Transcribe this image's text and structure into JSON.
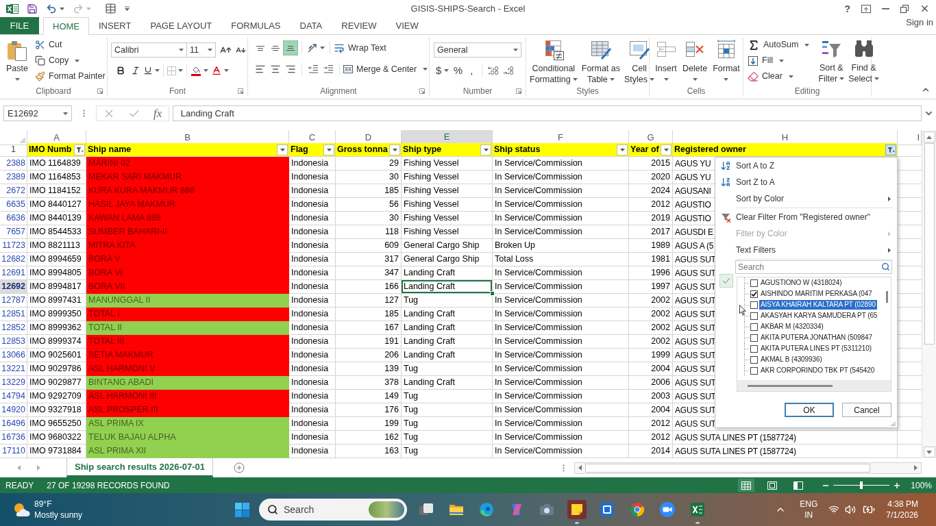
{
  "window": {
    "title": "GISIS-SHIPS-Search - Excel",
    "help": "?",
    "sign_in": "Sign in"
  },
  "ribbon_tabs": [
    {
      "label": "FILE",
      "kind": "file",
      "selected": false
    },
    {
      "label": "HOME",
      "kind": "tab",
      "selected": true
    },
    {
      "label": "INSERT",
      "kind": "tab",
      "selected": false
    },
    {
      "label": "PAGE LAYOUT",
      "kind": "tab",
      "selected": false
    },
    {
      "label": "FORMULAS",
      "kind": "tab",
      "selected": false
    },
    {
      "label": "DATA",
      "kind": "tab",
      "selected": false
    },
    {
      "label": "REVIEW",
      "kind": "tab",
      "selected": false
    },
    {
      "label": "VIEW",
      "kind": "tab",
      "selected": false
    }
  ],
  "ribbon": {
    "clipboard": {
      "label": "Clipboard",
      "paste": "Paste",
      "cut": "Cut",
      "copy": "Copy",
      "format_painter": "Format Painter"
    },
    "font": {
      "label": "Font",
      "font_name": "Calibri",
      "font_size": "11"
    },
    "alignment": {
      "label": "Alignment",
      "vertical": [
        {
          "kind": "top",
          "selected": false
        },
        {
          "kind": "middle",
          "selected": false
        },
        {
          "kind": "bottom",
          "selected": true
        }
      ],
      "wrap_text": "Wrap Text",
      "merge_center": "Merge & Center"
    },
    "number": {
      "label": "Number",
      "format": "General",
      "symbols": [
        {
          "label": "$",
          "menu": true
        },
        {
          "label": "%",
          "menu": false
        },
        {
          "label": ",",
          "menu": false
        }
      ]
    },
    "styles": {
      "label": "Styles",
      "buttons": [
        {
          "kind": "conditional",
          "lines": [
            "Conditional",
            "Formatting"
          ]
        },
        {
          "kind": "table",
          "lines": [
            "Format as",
            "Table"
          ]
        },
        {
          "kind": "cell_styles",
          "lines": [
            "Cell",
            "Styles"
          ]
        }
      ]
    },
    "cells": {
      "label": "Cells",
      "buttons": [
        {
          "kind": "insert",
          "lines": [
            "Insert"
          ]
        },
        {
          "kind": "delete",
          "lines": [
            "Delete"
          ]
        },
        {
          "kind": "format",
          "lines": [
            "Format"
          ]
        }
      ]
    },
    "editing": {
      "label": "Editing",
      "small": [
        {
          "kind": "autosum",
          "label": "AutoSum"
        },
        {
          "kind": "fill",
          "label": "Fill"
        },
        {
          "kind": "clear",
          "label": "Clear"
        }
      ],
      "big": [
        {
          "kind": "sort",
          "lines": [
            "Sort &",
            "Filter"
          ]
        },
        {
          "kind": "find",
          "lines": [
            "Find &",
            "Select"
          ]
        }
      ]
    }
  },
  "formula_bar": {
    "name_box": "E12692",
    "function_button": "fx",
    "formula": "Landing Craft"
  },
  "sheet": {
    "columns": [
      {
        "letter": "A",
        "selected": false
      },
      {
        "letter": "B",
        "selected": false
      },
      {
        "letter": "C",
        "selected": false
      },
      {
        "letter": "D",
        "selected": false
      },
      {
        "letter": "E",
        "selected": true
      },
      {
        "letter": "F",
        "selected": false
      },
      {
        "letter": "G",
        "selected": false
      },
      {
        "letter": "H",
        "selected": false
      },
      {
        "letter": "I",
        "selected": false
      }
    ],
    "header": {
      "number": "1",
      "cells": [
        {
          "text": "IMO Numb",
          "filtered": true,
          "open": false
        },
        {
          "text": "Ship name",
          "filtered": false,
          "open": false
        },
        {
          "text": "Flag",
          "filtered": false,
          "open": false
        },
        {
          "text": "Gross tonna",
          "filtered": false,
          "open": false
        },
        {
          "text": "Ship type",
          "filtered": false,
          "open": false
        },
        {
          "text": "Ship status",
          "filtered": false,
          "open": false
        },
        {
          "text": "Year of",
          "filtered": false,
          "open": false
        },
        {
          "text": "Registered owner",
          "filtered": true,
          "open": true
        }
      ]
    },
    "rows": [
      {
        "number": "2388",
        "imo": "IMO 1164839",
        "name": "MARINI 02",
        "color": "#ff0000",
        "flag": "Indonesia",
        "gt": "29",
        "type": "Fishing Vessel",
        "status": "In Service/Commission",
        "year": "2015",
        "owner": "AGUS YU",
        "selected": false
      },
      {
        "number": "2389",
        "imo": "IMO 1164853",
        "name": "MEKAR SARI MAKMUR",
        "color": "#ff0000",
        "flag": "Indonesia",
        "gt": "30",
        "type": "Fishing Vessel",
        "status": "In Service/Commission",
        "year": "2020",
        "owner": "AGUS YU",
        "selected": false
      },
      {
        "number": "2672",
        "imo": "IMO 1184152",
        "name": "KURA KURA MAKMUR 888",
        "color": "#ff0000",
        "flag": "Indonesia",
        "gt": "185",
        "type": "Fishing Vessel",
        "status": "In Service/Commission",
        "year": "2024",
        "owner": "AGUSANI",
        "selected": false
      },
      {
        "number": "6635",
        "imo": "IMO 8440127",
        "name": "HASIL JAYA MAKMUR",
        "color": "#ff0000",
        "flag": "Indonesia",
        "gt": "56",
        "type": "Fishing Vessel",
        "status": "In Service/Commission",
        "year": "2012",
        "owner": "AGUSTIO",
        "selected": false
      },
      {
        "number": "6636",
        "imo": "IMO 8440139",
        "name": "KAWAN LAMA 888",
        "color": "#ff0000",
        "flag": "Indonesia",
        "gt": "30",
        "type": "Fishing Vessel",
        "status": "In Service/Commission",
        "year": "2019",
        "owner": "AGUSTIO",
        "selected": false
      },
      {
        "number": "7657",
        "imo": "IMO 8544533",
        "name": "SUMBER BAHARI-II",
        "color": "#ff0000",
        "flag": "Indonesia",
        "gt": "118",
        "type": "Fishing Vessel",
        "status": "In Service/Commission",
        "year": "2017",
        "owner": "AGUSDI E",
        "selected": false
      },
      {
        "number": "11723",
        "imo": "IMO 8821113",
        "name": "MITRA KITA",
        "color": "#ff0000",
        "flag": "Indonesia",
        "gt": "609",
        "type": "General Cargo Ship",
        "status": "Broken Up",
        "year": "1989",
        "owner": "AGUS A (5",
        "selected": false
      },
      {
        "number": "12682",
        "imo": "IMO 8994659",
        "name": "BORA V",
        "color": "#ff0000",
        "flag": "Indonesia",
        "gt": "317",
        "type": "General Cargo Ship",
        "status": "Total Loss",
        "year": "1981",
        "owner": "AGUS SUT",
        "selected": false
      },
      {
        "number": "12691",
        "imo": "IMO 8994805",
        "name": "BORA VI",
        "color": "#ff0000",
        "flag": "Indonesia",
        "gt": "347",
        "type": "Landing Craft",
        "status": "In Service/Commission",
        "year": "1996",
        "owner": "AGUS SUT",
        "selected": false
      },
      {
        "number": "12692",
        "imo": "IMO 8994817",
        "name": "BORA VII",
        "color": "#ff0000",
        "flag": "Indonesia",
        "gt": "166",
        "type": "Landing Craft",
        "status": "In Service/Commission",
        "year": "1997",
        "owner": "AGUS SUT",
        "selected": true
      },
      {
        "number": "12787",
        "imo": "IMO 8997431",
        "name": "MANUNGGAL II",
        "color": "#92d050",
        "flag": "Indonesia",
        "gt": "127",
        "type": "Tug",
        "status": "In Service/Commission",
        "year": "2002",
        "owner": "AGUS SUT",
        "selected": false
      },
      {
        "number": "12851",
        "imo": "IMO 8999350",
        "name": "TOTAL I",
        "color": "#ff0000",
        "flag": "Indonesia",
        "gt": "185",
        "type": "Landing Craft",
        "status": "In Service/Commission",
        "year": "2002",
        "owner": "AGUS SUT",
        "selected": false
      },
      {
        "number": "12852",
        "imo": "IMO 8999362",
        "name": "TOTAL II",
        "color": "#92d050",
        "flag": "Indonesia",
        "gt": "167",
        "type": "Landing Craft",
        "status": "In Service/Commission",
        "year": "2002",
        "owner": "AGUS SUT",
        "selected": false
      },
      {
        "number": "12853",
        "imo": "IMO 8999374",
        "name": "TOTAL III",
        "color": "#ff0000",
        "flag": "Indonesia",
        "gt": "191",
        "type": "Landing Craft",
        "status": "In Service/Commission",
        "year": "2002",
        "owner": "AGUS SUT",
        "selected": false
      },
      {
        "number": "13066",
        "imo": "IMO 9025601",
        "name": "SETIA MAKMUR",
        "color": "#ff0000",
        "flag": "Indonesia",
        "gt": "206",
        "type": "Landing Craft",
        "status": "In Service/Commission",
        "year": "1999",
        "owner": "AGUS SUT",
        "selected": false
      },
      {
        "number": "13221",
        "imo": "IMO 9029786",
        "name": "ASL HARMONI V",
        "color": "#ff0000",
        "flag": "Indonesia",
        "gt": "139",
        "type": "Tug",
        "status": "In Service/Commission",
        "year": "2004",
        "owner": "AGUS SUT",
        "selected": false
      },
      {
        "number": "13229",
        "imo": "IMO 9029877",
        "name": "BINTANG ABADI",
        "color": "#92d050",
        "flag": "Indonesia",
        "gt": "378",
        "type": "Landing Craft",
        "status": "In Service/Commission",
        "year": "2006",
        "owner": "AGUS SUT",
        "selected": false
      },
      {
        "number": "14794",
        "imo": "IMO 9292709",
        "name": "ASL HARMONI III",
        "color": "#ff0000",
        "flag": "Indonesia",
        "gt": "149",
        "type": "Tug",
        "status": "In Service/Commission",
        "year": "2003",
        "owner": "AGUS SUT",
        "selected": false
      },
      {
        "number": "14920",
        "imo": "IMO 9327918",
        "name": "ASL PROSPER III",
        "color": "#ff0000",
        "flag": "Indonesia",
        "gt": "176",
        "type": "Tug",
        "status": "In Service/Commission",
        "year": "2004",
        "owner": "AGUS SUT",
        "selected": false
      },
      {
        "number": "16496",
        "imo": "IMO 9655250",
        "name": "ASL PRIMA IX",
        "color": "#92d050",
        "flag": "Indonesia",
        "gt": "199",
        "type": "Tug",
        "status": "In Service/Commission",
        "year": "2012",
        "owner": "AGUS SUT",
        "selected": false
      },
      {
        "number": "16736",
        "imo": "IMO 9680322",
        "name": "TELUK BAJAU ALPHA",
        "color": "#92d050",
        "flag": "Indonesia",
        "gt": "162",
        "type": "Tug",
        "status": "In Service/Commission",
        "year": "2012",
        "owner": "AGUS SUTA LINES PT (1587724)",
        "selected": false
      },
      {
        "number": "17110",
        "imo": "IMO 9731884",
        "name": "ASL PRIMA XII",
        "color": "#92d050",
        "flag": "Indonesia",
        "gt": "163",
        "type": "Tug",
        "status": "In Service/Commission",
        "year": "2014",
        "owner": "AGUS SUTA LINES PT (1587724)",
        "selected": false
      }
    ]
  },
  "filter_menu": {
    "items": [
      {
        "kind": "sort_asc",
        "label": "Sort A to Z",
        "disabled": false,
        "submenu": false,
        "divider_above": false
      },
      {
        "kind": "sort_desc",
        "label": "Sort Z to A",
        "disabled": false,
        "submenu": false,
        "divider_above": false
      },
      {
        "kind": "sort_color",
        "label": "Sort by Color",
        "disabled": false,
        "submenu": true,
        "divider_above": false
      },
      {
        "kind": "clear",
        "label": "Clear Filter From \"Registered owner\"",
        "disabled": false,
        "submenu": false,
        "divider_above": true
      },
      {
        "kind": "color",
        "label": "Filter by Color",
        "disabled": true,
        "submenu": true,
        "divider_above": false
      },
      {
        "kind": "text",
        "label": "Text Filters",
        "disabled": false,
        "submenu": true,
        "divider_above": false
      }
    ],
    "search_placeholder": "Search",
    "values": [
      {
        "label": "AGUSTIONO W (4318024)",
        "checked": false,
        "selected": false
      },
      {
        "label": "AISHINDO MARITIM PERKASA (047",
        "checked": true,
        "selected": false
      },
      {
        "label": "AISYA KHAIRAH KALTARA PT (02890",
        "checked": false,
        "selected": true
      },
      {
        "label": "AKASYAH KARYA SAMUDERA PT (65",
        "checked": false,
        "selected": false
      },
      {
        "label": "AKBAR M (4320334)",
        "checked": false,
        "selected": false
      },
      {
        "label": "AKITA PUTERA JONATHAN (509847",
        "checked": false,
        "selected": false
      },
      {
        "label": "AKITA PUTERA LINES PT (5311210)",
        "checked": false,
        "selected": false
      },
      {
        "label": "AKMAL B (4309936)",
        "checked": false,
        "selected": false
      },
      {
        "label": "AKR CORPORINDO TBK PT (545420",
        "checked": false,
        "selected": false
      }
    ],
    "buttons": [
      {
        "label": "OK",
        "focused": true
      },
      {
        "label": "Cancel",
        "focused": false
      }
    ]
  },
  "sheet_tabs": [
    {
      "label": "Ship search results 2026-07-01",
      "selected": true
    }
  ],
  "status_bar": {
    "mode": "READY",
    "message": "27 OF 19298 RECORDS FOUND",
    "views": [
      {
        "kind": "normal",
        "selected": true
      },
      {
        "kind": "page_layout",
        "selected": false
      },
      {
        "kind": "page_break",
        "selected": false
      }
    ],
    "zoom": {
      "level": 0.5,
      "label": "100%"
    }
  },
  "taskbar": {
    "weather": {
      "temperature": "89°F",
      "condition": "Mostly sunny"
    },
    "search_placeholder": "Search",
    "apps": [
      {
        "kind": "task_view",
        "running": false
      },
      {
        "kind": "file_explorer",
        "running": false
      },
      {
        "kind": "edge",
        "running": false
      },
      {
        "kind": "copilot",
        "running": false
      },
      {
        "kind": "camera",
        "running": false
      },
      {
        "kind": "sticky_notes",
        "running": true
      },
      {
        "kind": "capture",
        "running": false
      },
      {
        "kind": "chrome",
        "running": false
      },
      {
        "kind": "zoom",
        "running": false
      },
      {
        "kind": "excel",
        "running": true
      }
    ],
    "tray": {
      "language": "ENG",
      "region": "IN",
      "time": "4:38 PM",
      "date": "7/1/2026"
    }
  }
}
